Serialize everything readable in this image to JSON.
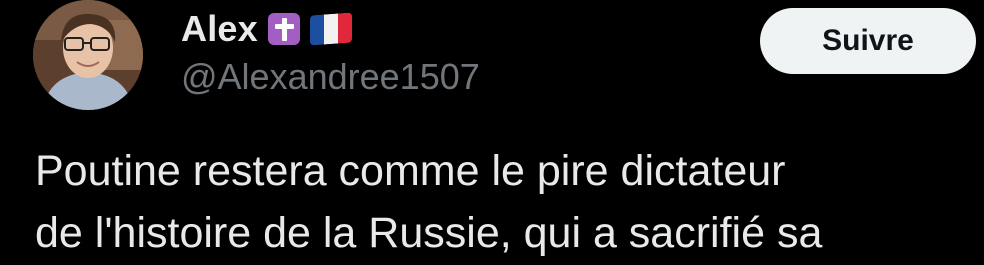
{
  "author": {
    "display_name": "Alex",
    "handle": "@Alexandree1507",
    "badge_icons": [
      "latin-cross-emoji",
      "france-flag-emoji"
    ]
  },
  "follow_button": {
    "label": "Suivre"
  },
  "tweet": {
    "text_lines": [
      "Poutine restera comme le pire dictateur",
      "de l'histoire de la Russie, qui a sacrifié sa"
    ]
  },
  "colors": {
    "background": "#000000",
    "primary_text": "#e7e9ea",
    "secondary_text": "#71767b",
    "button_bg": "#eff3f4",
    "button_text": "#0f1419"
  }
}
